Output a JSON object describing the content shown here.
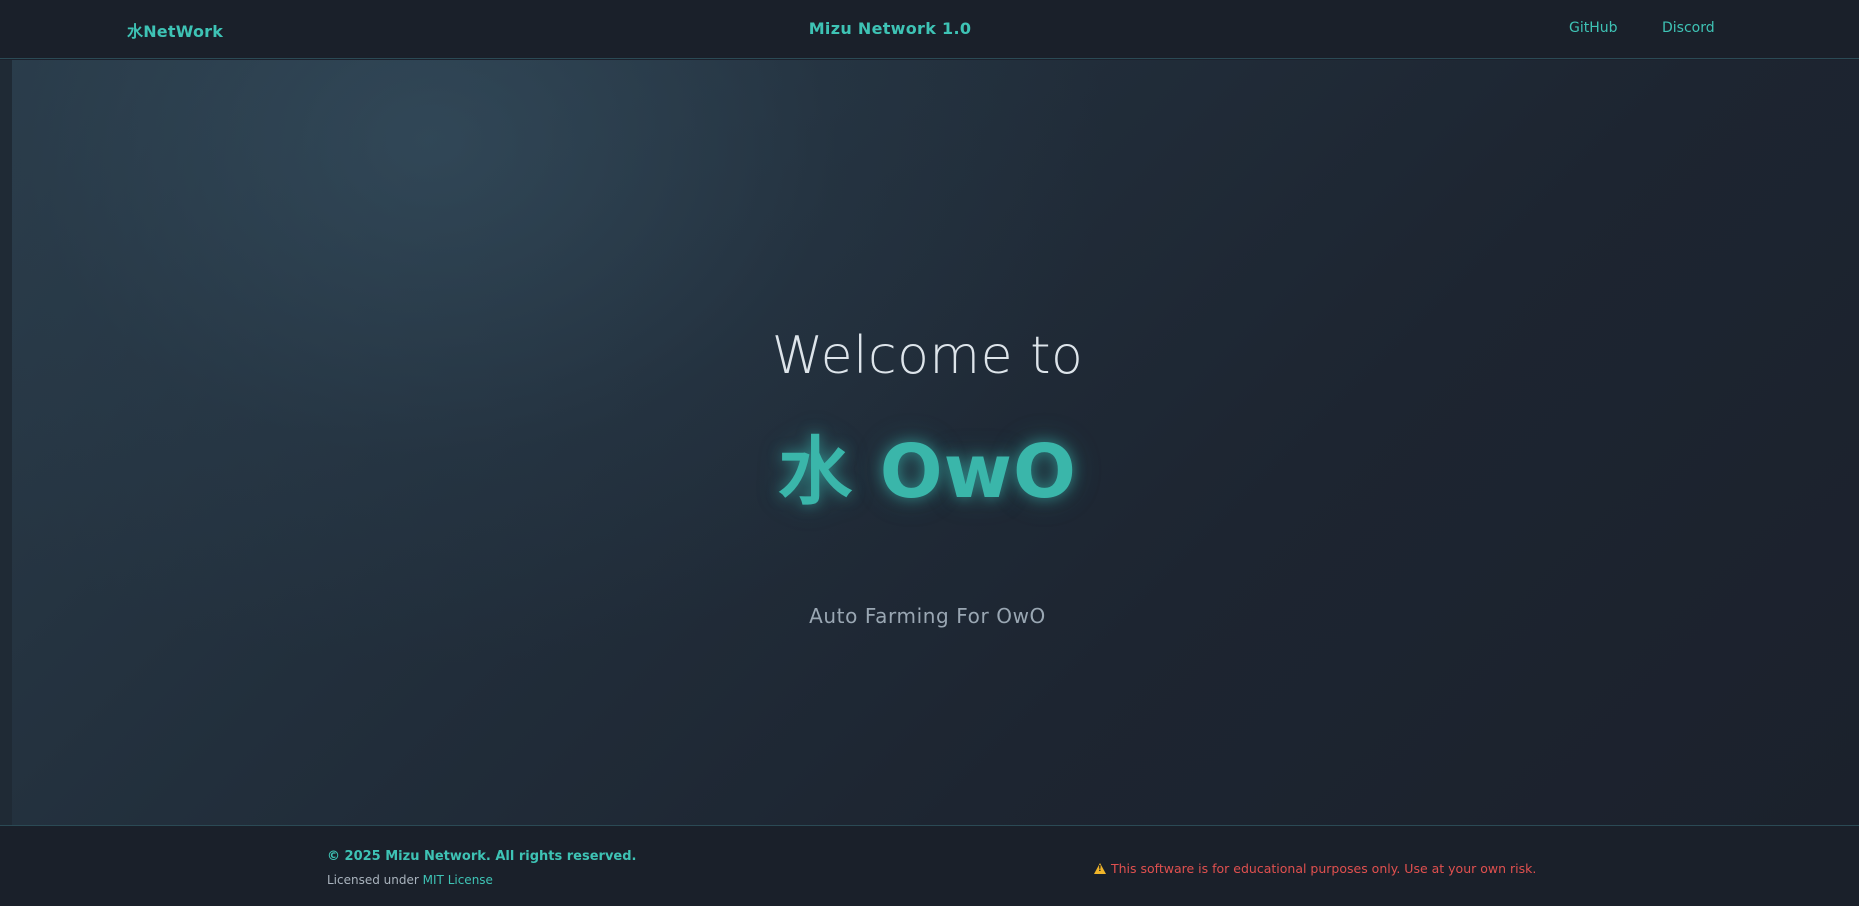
{
  "header": {
    "brand": "水NetWork",
    "title": "Mizu Network 1.0",
    "nav": [
      {
        "label": "GitHub"
      },
      {
        "label": "Discord"
      }
    ]
  },
  "hero": {
    "welcome": "Welcome to",
    "title": "水 OwO",
    "tagline": "Auto Farming For OwO"
  },
  "footer": {
    "copyright": "© 2025 Mizu Network. All rights reserved.",
    "license_prefix": "Licensed under",
    "license_link": "MIT License",
    "disclaimer": "This software is for educational purposes only. Use at your own risk."
  },
  "colors": {
    "accent": "#3ec3b5",
    "background": "#1b212c",
    "warning_text": "#e0504f",
    "warning_icon": "#f0b429"
  },
  "icons": {
    "disclaimer_icon": "warning-icon"
  }
}
